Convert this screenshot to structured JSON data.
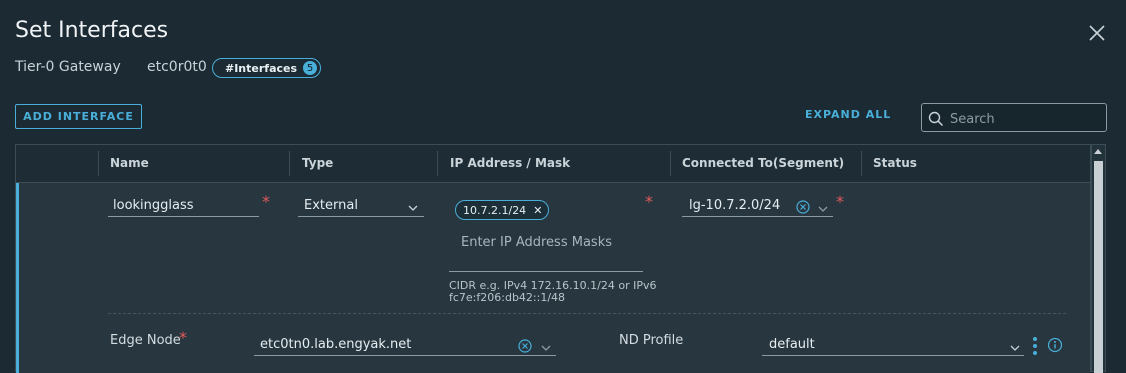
{
  "dialog": {
    "title": "Set Interfaces",
    "gateway_type": "Tier-0 Gateway",
    "gateway_name": "etc0r0t0",
    "interfaces_label": "#Interfaces",
    "interfaces_count": "5"
  },
  "toolbar": {
    "add_interface_label": "ADD INTERFACE",
    "expand_all_label": "EXPAND ALL",
    "search_placeholder": "Search"
  },
  "table": {
    "columns": [
      "Name",
      "Type",
      "IP Address / Mask",
      "Connected To(Segment)",
      "Status"
    ],
    "rows": [
      {
        "name": "lookingglass",
        "type": "External",
        "ip_chip": "10.7.2.1/24",
        "ip_placeholder": "Enter IP Address Masks",
        "ip_help": "CIDR e.g. IPv4 172.16.10.1/24 or IPv6 fc7e:f206:db42::1/48",
        "segment": "lg-10.7.2.0/24",
        "edge_node_label": "Edge Node",
        "edge_node_value": "etc0tn0.lab.engyak.net",
        "nd_profile_label": "ND Profile",
        "nd_profile_value": "default"
      }
    ]
  },
  "colors": {
    "background": "#1b2a33",
    "accent": "#49afd9",
    "required": "#e05a5a"
  },
  "icons": [
    "close-icon",
    "search-icon",
    "chevron-down-icon",
    "clear-circle-icon",
    "kebab-menu-icon",
    "info-icon",
    "scroll-up-icon"
  ]
}
